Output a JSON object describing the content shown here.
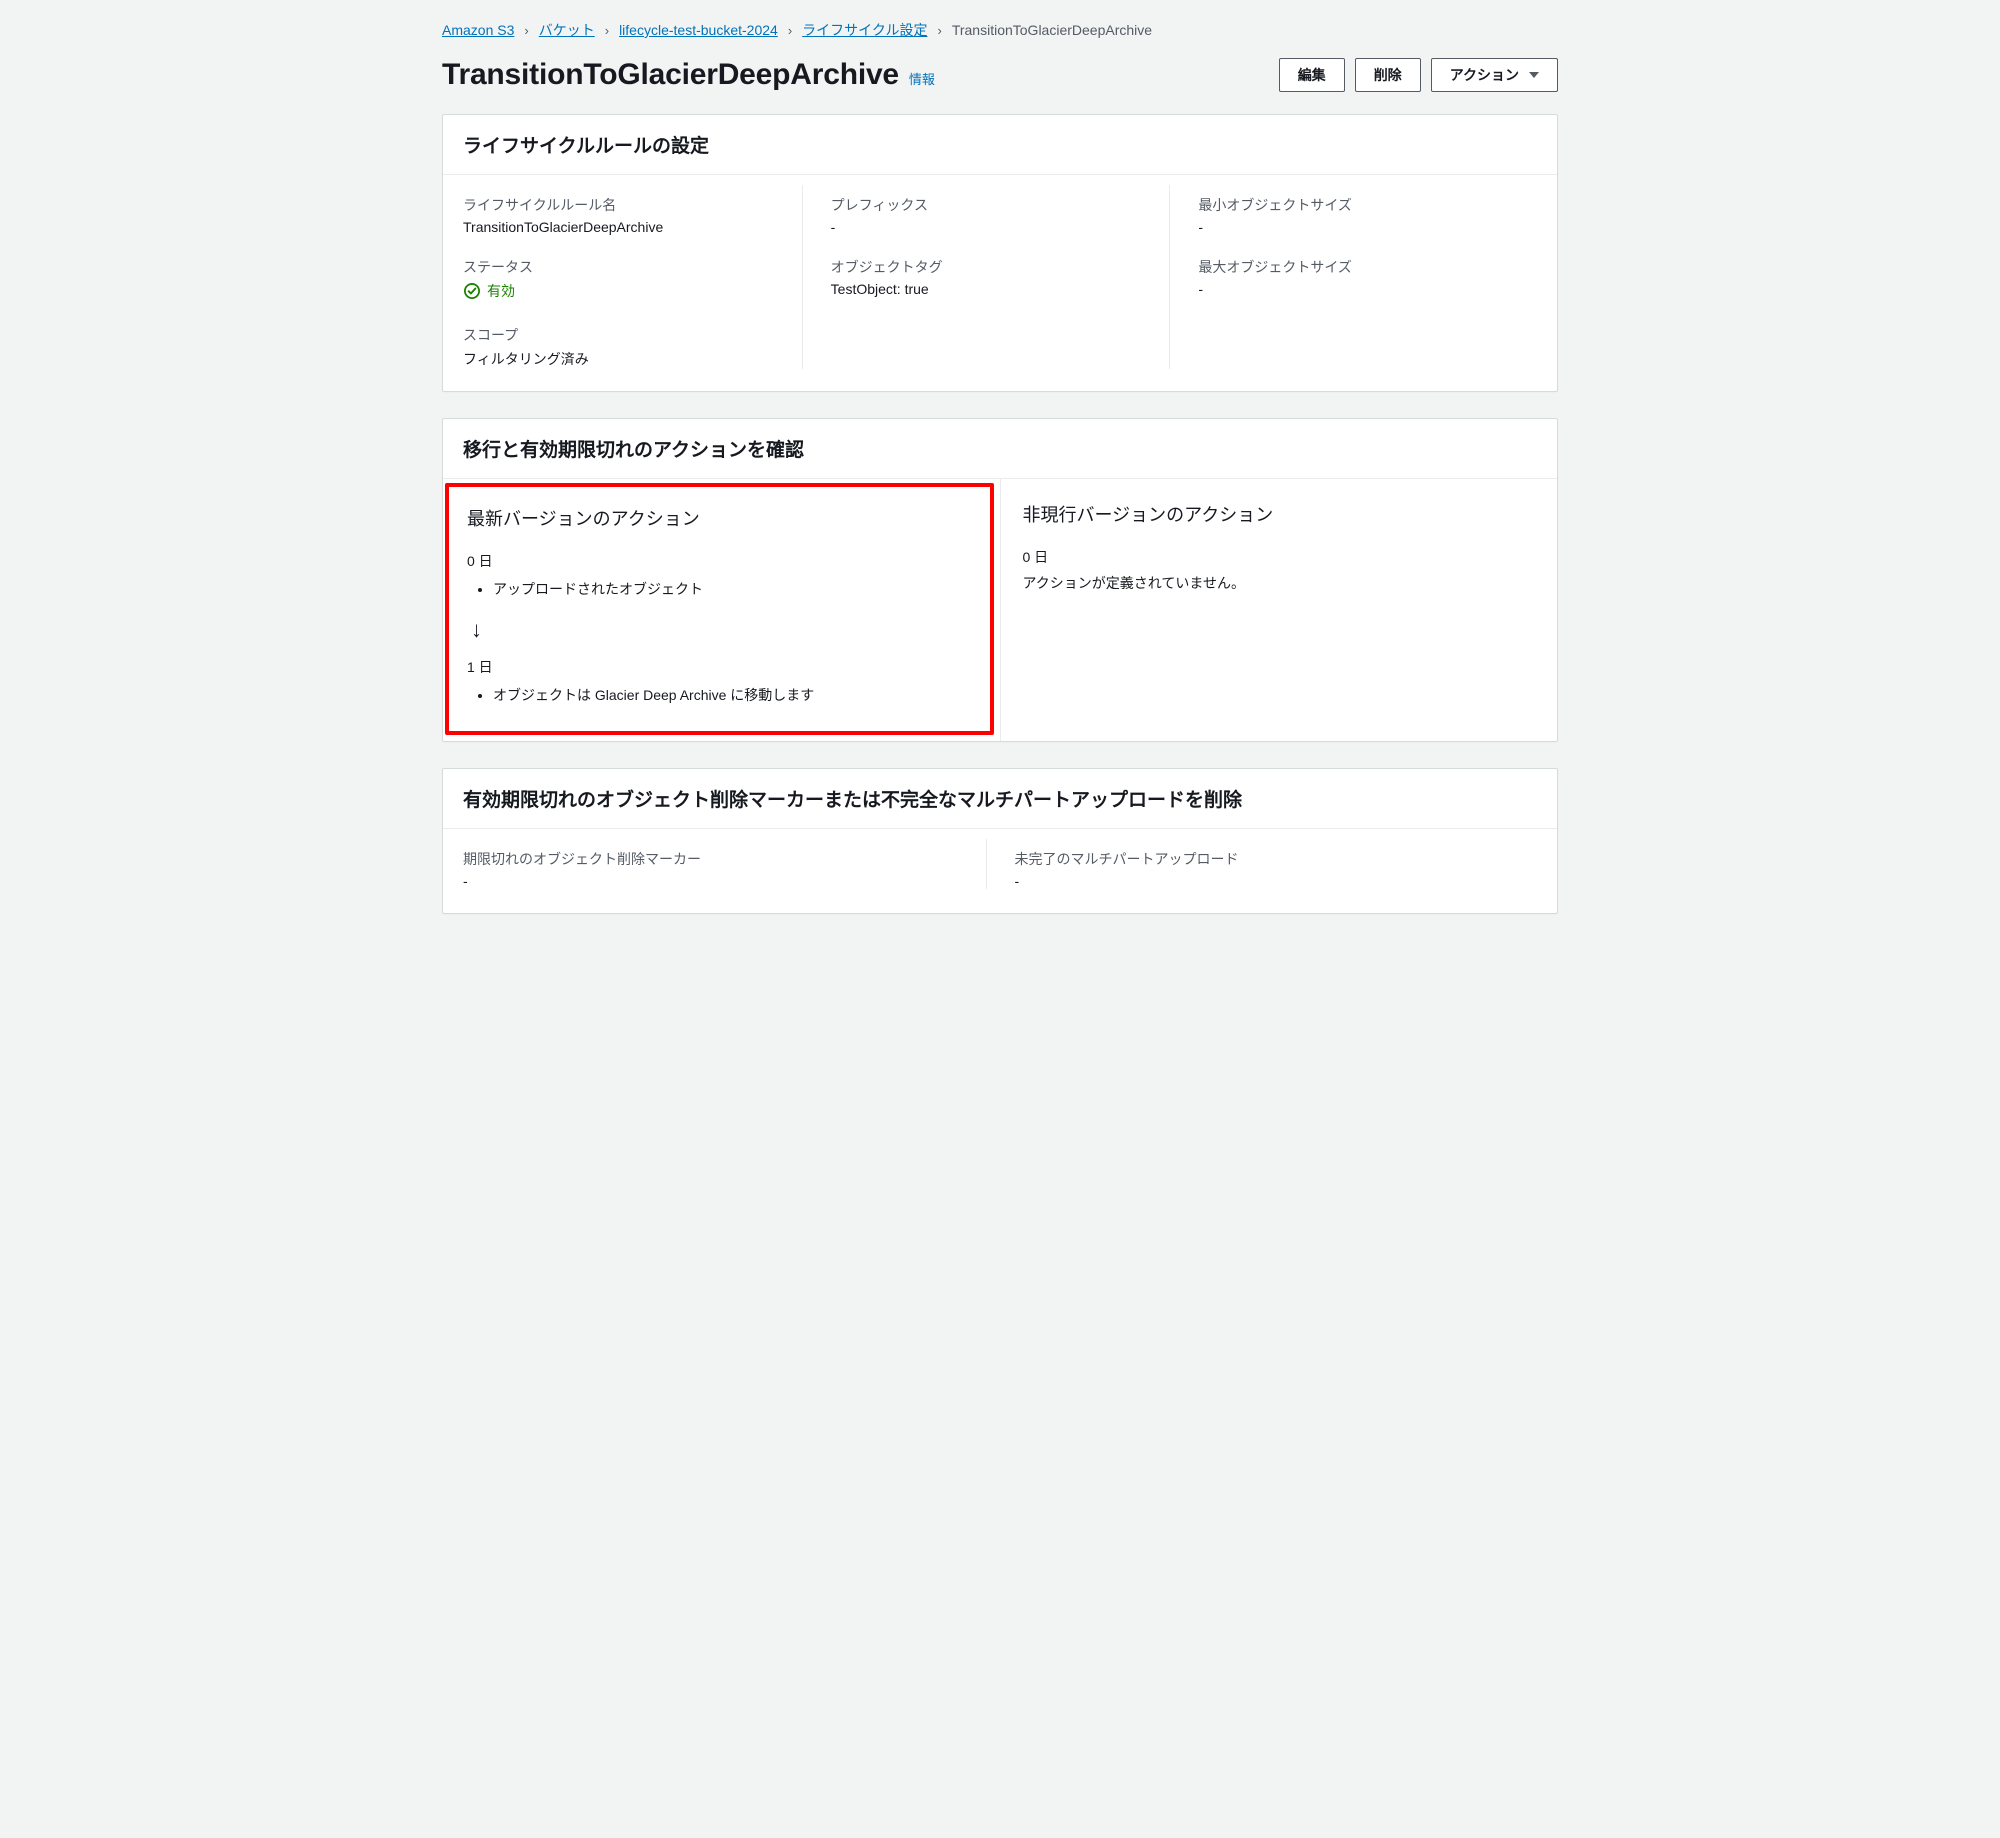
{
  "breadcrumb": {
    "s3": "Amazon S3",
    "buckets": "バケット",
    "bucket_name": "lifecycle-test-bucket-2024",
    "lifecycle": "ライフサイクル設定",
    "current": "TransitionToGlacierDeepArchive"
  },
  "header": {
    "title": "TransitionToGlacierDeepArchive",
    "info": "情報",
    "edit": "編集",
    "delete": "削除",
    "actions": "アクション"
  },
  "config": {
    "panel_title": "ライフサイクルルールの設定",
    "rule_name_label": "ライフサイクルルール名",
    "rule_name_value": "TransitionToGlacierDeepArchive",
    "status_label": "ステータス",
    "status_value": "有効",
    "scope_label": "スコープ",
    "scope_value": "フィルタリング済み",
    "prefix_label": "プレフィックス",
    "prefix_value": "-",
    "tags_label": "オブジェクトタグ",
    "tags_value": "TestObject: true",
    "min_size_label": "最小オブジェクトサイズ",
    "min_size_value": "-",
    "max_size_label": "最大オブジェクトサイズ",
    "max_size_value": "-"
  },
  "actions": {
    "panel_title": "移行と有効期限切れのアクションを確認",
    "current": {
      "title": "最新バージョンのアクション",
      "day0_label": "0 日",
      "day0_item": "アップロードされたオブジェクト",
      "day1_label": "1 日",
      "day1_item": "オブジェクトは Glacier Deep Archive に移動します"
    },
    "noncurrent": {
      "title": "非現行バージョンのアクション",
      "day0_label": "0 日",
      "note": "アクションが定義されていません。"
    }
  },
  "cleanup": {
    "panel_title": "有効期限切れのオブジェクト削除マーカーまたは不完全なマルチパートアップロードを削除",
    "expired_marker_label": "期限切れのオブジェクト削除マーカー",
    "expired_marker_value": "-",
    "incomplete_mpu_label": "未完了のマルチパートアップロード",
    "incomplete_mpu_value": "-"
  }
}
